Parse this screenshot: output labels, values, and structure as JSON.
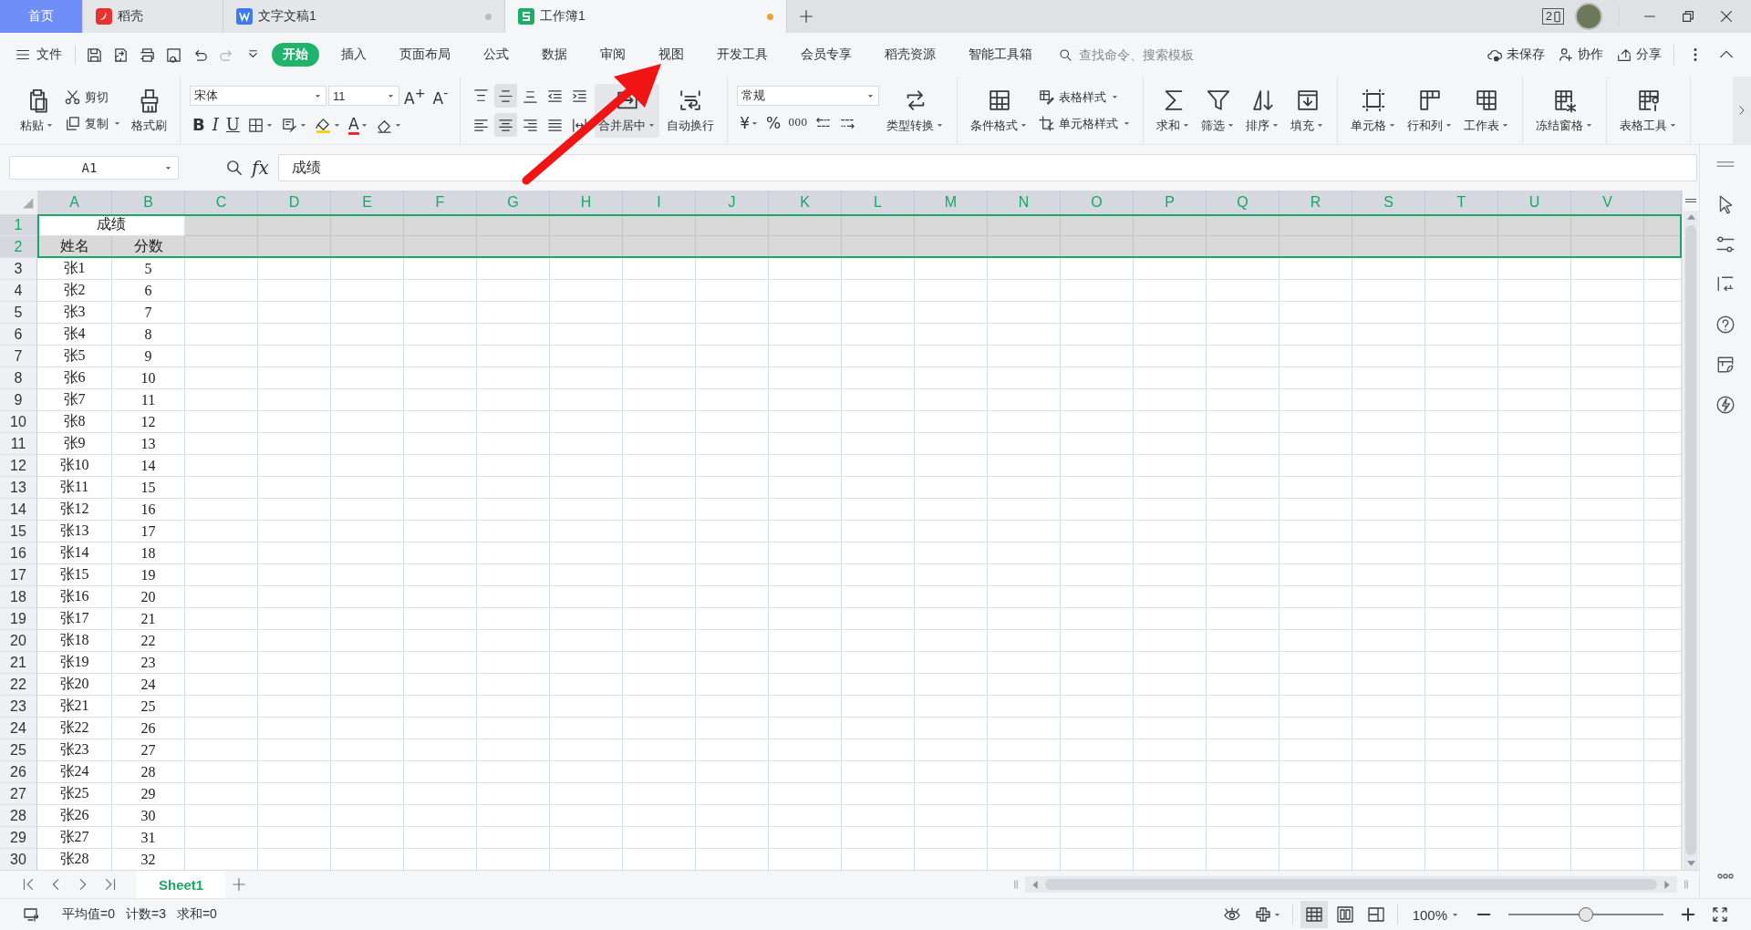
{
  "title_bar": {
    "tabs": [
      {
        "label": "首页",
        "kind": "home",
        "selected": false
      },
      {
        "label": "稻壳",
        "kind": "docer",
        "selected": false
      },
      {
        "label": "文字文稿1",
        "kind": "writer",
        "selected": false,
        "modified": false
      },
      {
        "label": "工作簿1",
        "kind": "sheet",
        "selected": true,
        "modified": true
      }
    ],
    "window_count": "2"
  },
  "menu": {
    "file": "文件",
    "quick_access": [
      {
        "disabled": false
      },
      {
        "disabled": false
      },
      {
        "disabled": false
      },
      {
        "disabled": false
      },
      {
        "disabled": false
      },
      {
        "disabled": true
      },
      {
        "disabled": false
      }
    ],
    "tabs": [
      {
        "label": "开始",
        "selected": true
      },
      {
        "label": "插入",
        "selected": false
      },
      {
        "label": "页面布局",
        "selected": false
      },
      {
        "label": "公式",
        "selected": false
      },
      {
        "label": "数据",
        "selected": false
      },
      {
        "label": "审阅",
        "selected": false
      },
      {
        "label": "视图",
        "selected": false
      },
      {
        "label": "开发工具",
        "selected": false
      },
      {
        "label": "会员专享",
        "selected": false
      },
      {
        "label": "稻壳资源",
        "selected": false
      },
      {
        "label": "智能工具箱",
        "selected": false
      }
    ],
    "search": {
      "placeholder": "查找命令、搜索模板"
    },
    "actions": [
      "未保存",
      "协作",
      "分享"
    ]
  },
  "ribbon": [
    {
      "columns": [
        {
          "kind": "large",
          "label": "粘贴",
          "dropdown": true
        },
        {
          "kind": "stack",
          "lines": [
            {
              "items": [
                {
                  "kind": "small",
                  "label": "剪切",
                  "dropdown": false
                }
              ]
            },
            {
              "items": [
                {
                  "kind": "small",
                  "label": "复制",
                  "dropdown": true
                }
              ]
            }
          ]
        },
        {
          "kind": "large",
          "label": "格式刷",
          "dropdown": false
        }
      ]
    },
    {
      "columns": [
        {
          "kind": "stack",
          "lines": [
            {
              "items": [
                {
                  "kind": "field",
                  "value": "宋体"
                },
                {
                  "kind": "field",
                  "value": "11"
                },
                {
                  "kind": "glyph",
                  "label": "A$^{+}$",
                  "dropdown": false
                },
                {
                  "kind": "glyph",
                  "label": "A$^{-}$",
                  "dropdown": false
                }
              ]
            },
            {
              "items": [
                {
                  "kind": "glyph",
                  "label": "B",
                  "dropdown": false
                },
                {
                  "kind": "glyph",
                  "label": "I",
                  "dropdown": false
                },
                {
                  "kind": "glyph",
                  "label": "U",
                  "dropdown": false
                },
                {
                  "kind": "tool",
                  "dropdown": true
                },
                {
                  "kind": "tool",
                  "dropdown": true
                },
                {
                  "kind": "tool",
                  "dropdown": true
                },
                {
                  "kind": "color-glyph",
                  "label": "A",
                  "color": "#f02a2a",
                  "dropdown": true
                },
                {
                  "kind": "tool",
                  "dropdown": true
                }
              ]
            }
          ]
        }
      ]
    },
    {
      "columns": [
        {
          "kind": "stack",
          "lines": [
            {
              "items": [
                {
                  "kind": "tool",
                  "dropdown": false,
                  "on": false
                },
                {
                  "kind": "tool",
                  "dropdown": false,
                  "on": true
                },
                {
                  "kind": "tool",
                  "dropdown": false,
                  "on": false
                },
                {
                  "kind": "tool",
                  "dropdown": false,
                  "on": false
                },
                {
                  "kind": "tool",
                  "dropdown": false,
                  "on": false
                }
              ]
            },
            {
              "items": [
                {
                  "kind": "tool",
                  "dropdown": false,
                  "on": false
                },
                {
                  "kind": "tool",
                  "dropdown": false,
                  "on": true
                },
                {
                  "kind": "tool",
                  "dropdown": false,
                  "on": false
                },
                {
                  "kind": "tool",
                  "dropdown": false,
                  "on": false
                },
                {
                  "kind": "tool",
                  "dropdown": false,
                  "on": false
                }
              ]
            }
          ]
        },
        {
          "kind": "large",
          "label": "合并居中",
          "dropdown": true,
          "on": true
        },
        {
          "kind": "large",
          "label": "自动换行",
          "dropdown": false,
          "on": false
        }
      ]
    },
    {
      "columns": [
        {
          "kind": "stack",
          "lines": [
            {
              "items": [
                {
                  "kind": "field",
                  "value": "常规"
                }
              ]
            },
            {
              "items": [
                {
                  "kind": "glyph",
                  "label": "¥",
                  "dropdown": true
                },
                {
                  "kind": "glyph",
                  "label": "%",
                  "dropdown": false
                },
                {
                  "kind": "glyph",
                  "label": "000",
                  "dropdown": false
                },
                {
                  "kind": "tool",
                  "dropdown": false
                },
                {
                  "kind": "tool",
                  "dropdown": false
                }
              ]
            }
          ]
        },
        {
          "kind": "large",
          "label": "类型转换",
          "dropdown": true
        }
      ]
    },
    {
      "columns": [
        {
          "kind": "large",
          "label": "条件格式",
          "dropdown": true
        },
        {
          "kind": "stack",
          "lines": [
            {
              "items": [
                {
                  "kind": "small",
                  "label": "表格样式",
                  "dropdown": true
                }
              ]
            },
            {
              "items": [
                {
                  "kind": "small",
                  "label": "单元格样式",
                  "dropdown": true
                }
              ]
            }
          ]
        }
      ]
    },
    {
      "columns": [
        {
          "kind": "large",
          "label": "求和",
          "dropdown": true
        },
        {
          "kind": "large",
          "label": "筛选",
          "dropdown": true
        },
        {
          "kind": "large",
          "label": "排序",
          "dropdown": true
        },
        {
          "kind": "large",
          "label": "填充",
          "dropdown": true
        }
      ]
    },
    {
      "columns": [
        {
          "kind": "large",
          "label": "单元格",
          "dropdown": true
        },
        {
          "kind": "large",
          "label": "行和列",
          "dropdown": true
        },
        {
          "kind": "large",
          "label": "工作表",
          "dropdown": true
        }
      ]
    },
    {
      "columns": [
        {
          "kind": "large",
          "label": "冻结窗格",
          "dropdown": true
        }
      ]
    },
    {
      "columns": [
        {
          "kind": "large",
          "label": "表格工具",
          "dropdown": true
        }
      ]
    }
  ],
  "formula_bar": {
    "name_box": "A1",
    "fx": "fx",
    "value": "成绩"
  },
  "sheet": {
    "columns": [
      {
        "label": "A",
        "selected": true
      },
      {
        "label": "B",
        "selected": true
      },
      {
        "label": "C",
        "selected": true
      },
      {
        "label": "D",
        "selected": true
      },
      {
        "label": "E",
        "selected": true
      },
      {
        "label": "F",
        "selected": true
      },
      {
        "label": "G",
        "selected": true
      },
      {
        "label": "H",
        "selected": true
      },
      {
        "label": "I",
        "selected": true
      },
      {
        "label": "J",
        "selected": true
      },
      {
        "label": "K",
        "selected": true
      },
      {
        "label": "L",
        "selected": true
      },
      {
        "label": "M",
        "selected": true
      },
      {
        "label": "N",
        "selected": true
      },
      {
        "label": "O",
        "selected": true
      },
      {
        "label": "P",
        "selected": true
      },
      {
        "label": "Q",
        "selected": true
      },
      {
        "label": "R",
        "selected": true
      },
      {
        "label": "S",
        "selected": true
      },
      {
        "label": "T",
        "selected": true
      },
      {
        "label": "U",
        "selected": true
      },
      {
        "label": "V",
        "selected": true
      }
    ],
    "rows": [
      {
        "number": "1",
        "selected": true,
        "cells": [
          {
            "text": "成绩",
            "kind": "merged",
            "active": true
          }
        ]
      },
      {
        "number": "2",
        "selected": true,
        "cells": [
          {
            "text": "姓名",
            "active": false
          },
          {
            "text": "分数",
            "active": false
          }
        ]
      },
      {
        "number": "3",
        "selected": false,
        "cells": [
          {
            "text": "张1",
            "active": false
          },
          {
            "text": "5",
            "active": false
          }
        ]
      },
      {
        "number": "4",
        "selected": false,
        "cells": [
          {
            "text": "张2",
            "active": false
          },
          {
            "text": "6",
            "active": false
          }
        ]
      },
      {
        "number": "5",
        "selected": false,
        "cells": [
          {
            "text": "张3",
            "active": false
          },
          {
            "text": "7",
            "active": false
          }
        ]
      },
      {
        "number": "6",
        "selected": false,
        "cells": [
          {
            "text": "张4",
            "active": false
          },
          {
            "text": "8",
            "active": false
          }
        ]
      },
      {
        "number": "7",
        "selected": false,
        "cells": [
          {
            "text": "张5",
            "active": false
          },
          {
            "text": "9",
            "active": false
          }
        ]
      },
      {
        "number": "8",
        "selected": false,
        "cells": [
          {
            "text": "张6",
            "active": false
          },
          {
            "text": "10",
            "active": false
          }
        ]
      },
      {
        "number": "9",
        "selected": false,
        "cells": [
          {
            "text": "张7",
            "active": false
          },
          {
            "text": "11",
            "active": false
          }
        ]
      },
      {
        "number": "10",
        "selected": false,
        "cells": [
          {
            "text": "张8",
            "active": false
          },
          {
            "text": "12",
            "active": false
          }
        ]
      },
      {
        "number": "11",
        "selected": false,
        "cells": [
          {
            "text": "张9",
            "active": false
          },
          {
            "text": "13",
            "active": false
          }
        ]
      },
      {
        "number": "12",
        "selected": false,
        "cells": [
          {
            "text": "张10",
            "active": false
          },
          {
            "text": "14",
            "active": false
          }
        ]
      },
      {
        "number": "13",
        "selected": false,
        "cells": [
          {
            "text": "张11",
            "active": false
          },
          {
            "text": "15",
            "active": false
          }
        ]
      },
      {
        "number": "14",
        "selected": false,
        "cells": [
          {
            "text": "张12",
            "active": false
          },
          {
            "text": "16",
            "active": false
          }
        ]
      },
      {
        "number": "15",
        "selected": false,
        "cells": [
          {
            "text": "张13",
            "active": false
          },
          {
            "text": "17",
            "active": false
          }
        ]
      },
      {
        "number": "16",
        "selected": false,
        "cells": [
          {
            "text": "张14",
            "active": false
          },
          {
            "text": "18",
            "active": false
          }
        ]
      },
      {
        "number": "17",
        "selected": false,
        "cells": [
          {
            "text": "张15",
            "active": false
          },
          {
            "text": "19",
            "active": false
          }
        ]
      },
      {
        "number": "18",
        "selected": false,
        "cells": [
          {
            "text": "张16",
            "active": false
          },
          {
            "text": "20",
            "active": false
          }
        ]
      },
      {
        "number": "19",
        "selected": false,
        "cells": [
          {
            "text": "张17",
            "active": false
          },
          {
            "text": "21",
            "active": false
          }
        ]
      },
      {
        "number": "20",
        "selected": false,
        "cells": [
          {
            "text": "张18",
            "active": false
          },
          {
            "text": "22",
            "active": false
          }
        ]
      },
      {
        "number": "21",
        "selected": false,
        "cells": [
          {
            "text": "张19",
            "active": false
          },
          {
            "text": "23",
            "active": false
          }
        ]
      },
      {
        "number": "22",
        "selected": false,
        "cells": [
          {
            "text": "张20",
            "active": false
          },
          {
            "text": "24",
            "active": false
          }
        ]
      },
      {
        "number": "23",
        "selected": false,
        "cells": [
          {
            "text": "张21",
            "active": false
          },
          {
            "text": "25",
            "active": false
          }
        ]
      },
      {
        "number": "24",
        "selected": false,
        "cells": [
          {
            "text": "张22",
            "active": false
          },
          {
            "text": "26",
            "active": false
          }
        ]
      },
      {
        "number": "25",
        "selected": false,
        "cells": [
          {
            "text": "张23",
            "active": false
          },
          {
            "text": "27",
            "active": false
          }
        ]
      },
      {
        "number": "26",
        "selected": false,
        "cells": [
          {
            "text": "张24",
            "active": false
          },
          {
            "text": "28",
            "active": false
          }
        ]
      },
      {
        "number": "27",
        "selected": false,
        "cells": [
          {
            "text": "张25",
            "active": false
          },
          {
            "text": "29",
            "active": false
          }
        ]
      },
      {
        "number": "28",
        "selected": false,
        "cells": [
          {
            "text": "张26",
            "active": false
          },
          {
            "text": "30",
            "active": false
          }
        ]
      },
      {
        "number": "29",
        "selected": false,
        "cells": [
          {
            "text": "张27",
            "active": false
          },
          {
            "text": "31",
            "active": false
          }
        ]
      },
      {
        "number": "30",
        "selected": false,
        "cells": [
          {
            "text": "张28",
            "active": false
          },
          {
            "text": "32",
            "active": false
          }
        ]
      }
    ]
  },
  "sheet_tabs": [
    {
      "label": "Sheet1",
      "selected": true
    }
  ],
  "status_bar": {
    "stats": [
      "平均值=0",
      "计数=3",
      "求和=0"
    ],
    "views": [
      {
        "selected": true
      },
      {
        "selected": false
      },
      {
        "selected": false
      }
    ],
    "zoom": "100%",
    "zoom_slider": {
      "level": 0.5
    }
  }
}
